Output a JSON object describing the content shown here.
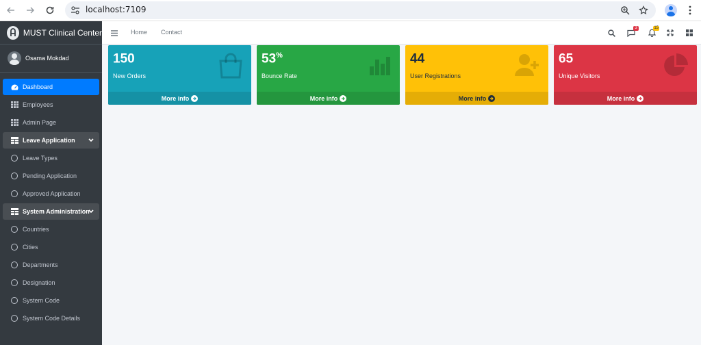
{
  "browser": {
    "url": "localhost:7109"
  },
  "sidebar": {
    "brand": "MUST Clinical Center",
    "user": "Osama Mokdad",
    "items": [
      {
        "label": "Dashboard",
        "icon": "tachometer-icon",
        "type": "active"
      },
      {
        "label": "Employees",
        "icon": "grid-icon",
        "type": "normal"
      },
      {
        "label": "Admin Page",
        "icon": "grid-icon",
        "type": "normal"
      },
      {
        "label": "Leave Application",
        "icon": "table-icon",
        "type": "group"
      },
      {
        "label": "Leave Types",
        "icon": "circle-icon",
        "type": "normal"
      },
      {
        "label": "Pending Application",
        "icon": "circle-icon",
        "type": "normal"
      },
      {
        "label": "Approved Application",
        "icon": "circle-icon",
        "type": "normal"
      },
      {
        "label": "System Administration",
        "icon": "table-icon",
        "type": "group"
      },
      {
        "label": "Countries",
        "icon": "circle-icon",
        "type": "normal"
      },
      {
        "label": "Cities",
        "icon": "circle-icon",
        "type": "normal"
      },
      {
        "label": "Departments",
        "icon": "circle-icon",
        "type": "normal"
      },
      {
        "label": "Designation",
        "icon": "circle-icon",
        "type": "normal"
      },
      {
        "label": "System Code",
        "icon": "circle-icon",
        "type": "normal"
      },
      {
        "label": "System Code Details",
        "icon": "circle-icon",
        "type": "normal"
      }
    ]
  },
  "navbar": {
    "links": [
      "Home",
      "Contact"
    ],
    "messages_badge": "3",
    "notifications_badge": "15"
  },
  "boxes": [
    {
      "value": "150",
      "suffix": "",
      "label": "New Orders",
      "footer": "More info",
      "color": "#17a2b8",
      "footer_color": "#1591a5",
      "text_color": "#ffffff",
      "icon": "shopping-bag-icon"
    },
    {
      "value": "53",
      "suffix": "%",
      "label": "Bounce Rate",
      "footer": "More info",
      "color": "#28a745",
      "footer_color": "#24963e",
      "text_color": "#ffffff",
      "icon": "bar-chart-icon"
    },
    {
      "value": "44",
      "suffix": "",
      "label": "User Registrations",
      "footer": "More info",
      "color": "#ffc107",
      "footer_color": "#e5ad06",
      "text_color": "#1f2d3d",
      "icon": "user-plus-icon"
    },
    {
      "value": "65",
      "suffix": "",
      "label": "Unique Visitors",
      "footer": "More info",
      "color": "#dc3545",
      "footer_color": "#c6303e",
      "text_color": "#ffffff",
      "icon": "pie-chart-icon"
    }
  ]
}
